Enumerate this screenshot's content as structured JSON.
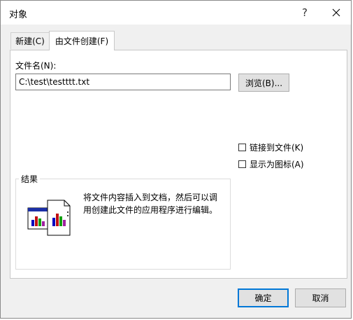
{
  "window": {
    "title": "对象",
    "help_label": "?"
  },
  "tabs": [
    {
      "label": "新建(C)",
      "active": false
    },
    {
      "label": "由文件创建(F)",
      "active": true
    }
  ],
  "file": {
    "label": "文件名(N):",
    "value": "C:\\test\\testttt.txt",
    "browse_label": "浏览(B)..."
  },
  "options": {
    "link_to_file": {
      "label": "链接到文件(K)",
      "checked": false
    },
    "display_as_icon": {
      "label": "显示为图标(A)",
      "checked": false
    }
  },
  "result": {
    "legend": "结果",
    "text": "将文件内容插入到文档，然后可以调用创建此文件的应用程序进行编辑。"
  },
  "buttons": {
    "ok_label": "确定",
    "cancel_label": "取消"
  },
  "colors": {
    "accent": "#0078d7",
    "dialog_bg": "#f0f0f0",
    "panel_bg": "#ffffff"
  }
}
